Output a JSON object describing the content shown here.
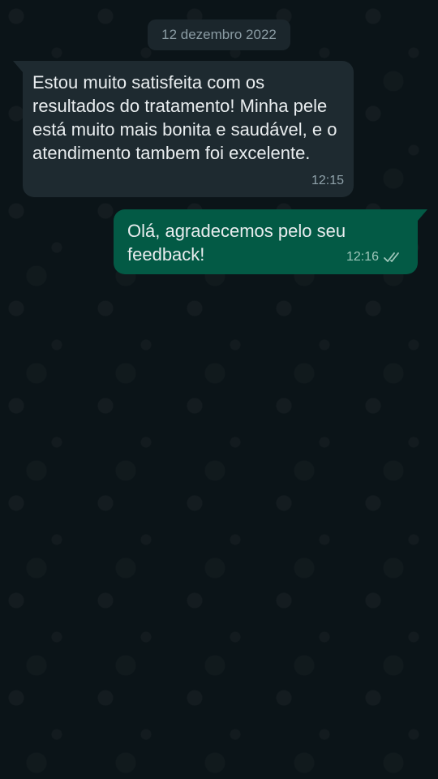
{
  "conversation": {
    "date_chip": "12 dezembro 2022",
    "messages": [
      {
        "direction": "incoming",
        "text": "Estou muito satisfeita com os resultados do tratamento! Minha pele está muito mais bonita e saudável, e o atendimento tambem foi excelente.",
        "time": "12:15"
      },
      {
        "direction": "outgoing",
        "text": "Olá, agradecemos pelo seu feedback!",
        "time": "12:16",
        "status_icon": "double-check-icon"
      }
    ]
  },
  "colors": {
    "background": "#0b1418",
    "incoming_bubble": "#1e2a30",
    "outgoing_bubble": "#035a45",
    "date_chip": "#1b262c"
  }
}
